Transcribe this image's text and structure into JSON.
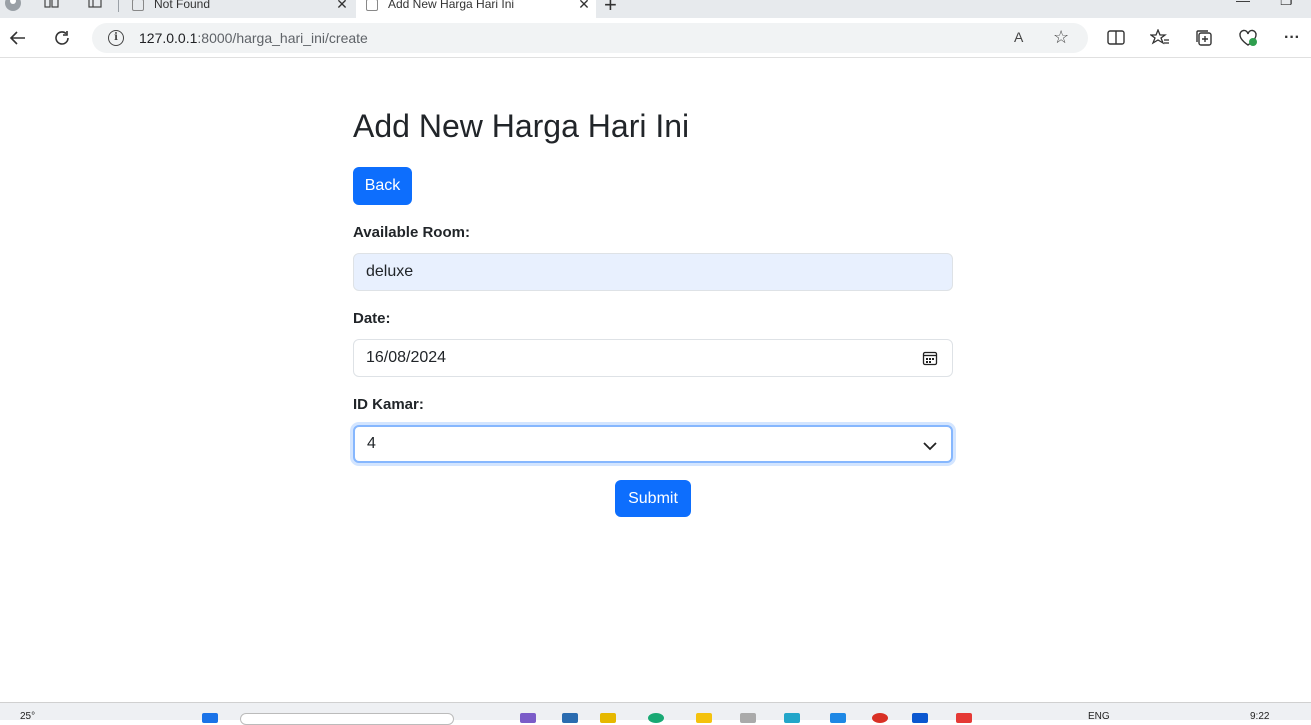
{
  "browser": {
    "tabs": [
      {
        "label": "Not Found",
        "active": false
      },
      {
        "label": "Add New Harga Hari Ini",
        "active": true
      }
    ],
    "address": {
      "host": "127.0.0.1",
      "path": ":8000/harga_hari_ini/create"
    },
    "read_aloud_label": "A",
    "close_glyph": "✕",
    "new_tab_glyph": "+",
    "more_glyph": "···"
  },
  "page": {
    "title": "Add New Harga Hari Ini",
    "back_label": "Back",
    "room_label": "Available Room:",
    "room_value": "deluxe",
    "date_label": "Date:",
    "date_value": "16/08/2024",
    "kamar_label": "ID Kamar:",
    "kamar_value": "4",
    "submit_label": "Submit"
  },
  "taskbar": {
    "weather": "25°",
    "lang": "ENG",
    "time": "9:22"
  },
  "colors": {
    "primary": "#0d6efd",
    "autofill_bg": "#e8f0fe",
    "focus_ring": "#86b7fe"
  }
}
